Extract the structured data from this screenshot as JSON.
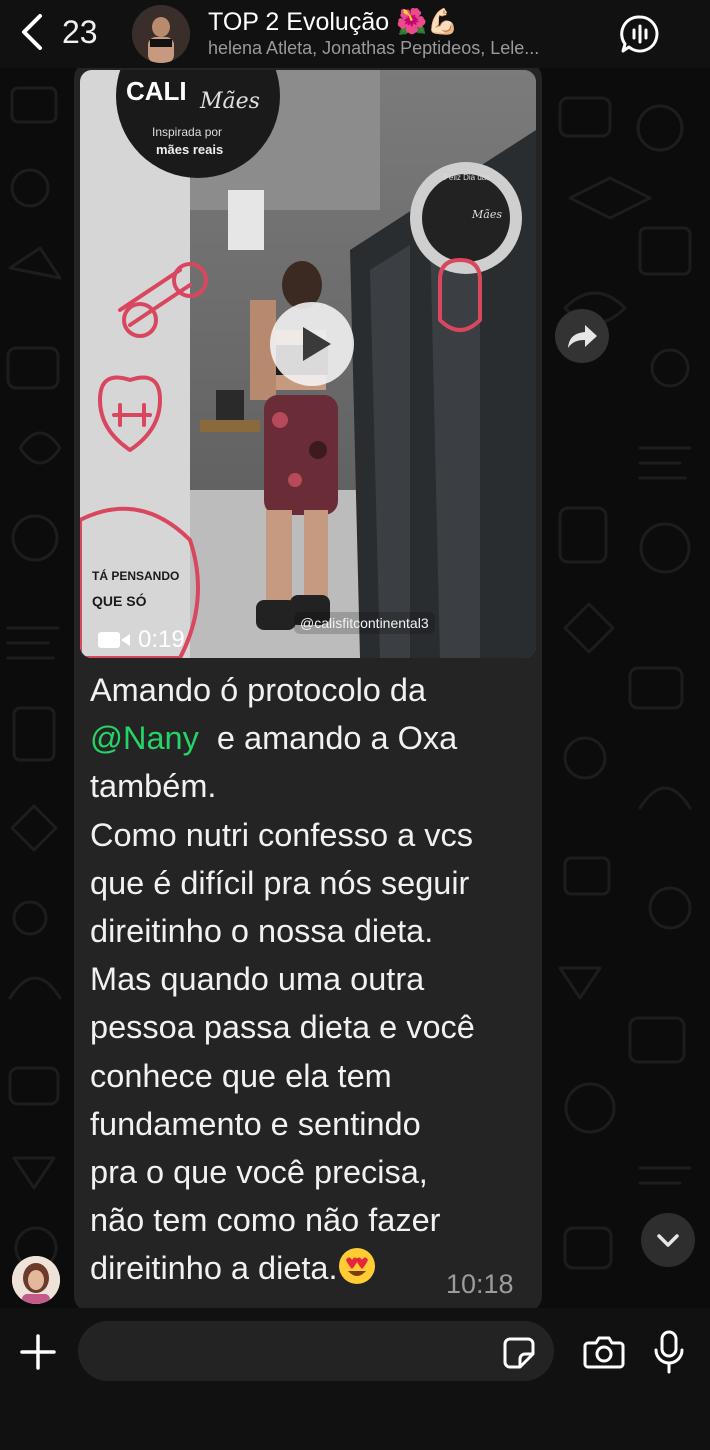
{
  "header": {
    "back_count": "23",
    "title": "TOP 2 Evolução 🌺💪🏻",
    "subtitle": "helena Atleta, Jonathas Peptideos, Lele..."
  },
  "message": {
    "video_duration": "0:19",
    "video_watermark": "@calisfitcontinental3",
    "text_before_mention": "Amando ó protocolo da\n",
    "mention": "@Nany",
    "text_after_mention": "  e amando a Oxa\ntambém.\nComo nutri confesso a vcs\nque é difícil pra nós seguir\ndireitinho o nossa dieta.\nMas quando uma outra\npessoa passa dieta e você\nconhece que ela tem\nfundamento e sentindo\npra o que você precisa,\nnão tem como não fazer\ndireitinho a dieta.",
    "time": "10:18",
    "emoji_name": "heart-eyes-emoji"
  },
  "media_texts": {
    "logo_brand": "CALI",
    "logo_script": "Mães",
    "logo_tag1": "Inspirada por",
    "logo_tag2": "mães reais",
    "sticker_line1": "Feliz Dia das",
    "sticker_line2": "Mães",
    "kettlebell_line1": "TÁ PENSANDO",
    "kettlebell_line2": "QUE SÓ"
  },
  "input": {
    "placeholder": ""
  },
  "icons": {
    "back": "chevron-left-icon",
    "call": "waveform-call-icon",
    "forward": "forward-arrow-icon",
    "scroll": "chevron-down-icon",
    "plus": "plus-icon",
    "sticker": "sticker-icon",
    "camera": "camera-icon",
    "mic": "microphone-icon"
  },
  "colors": {
    "mention": "#25d366",
    "bubble": "#242424",
    "bar": "#111111"
  }
}
